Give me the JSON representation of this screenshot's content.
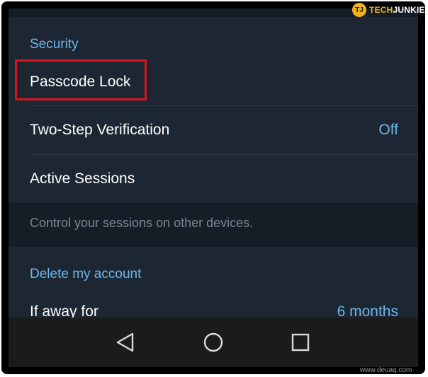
{
  "security": {
    "header": "Security",
    "passcode_lock": "Passcode Lock",
    "two_step": {
      "label": "Two-Step Verification",
      "value": "Off"
    },
    "active_sessions": "Active Sessions",
    "sessions_hint": "Control your sessions on other devices."
  },
  "delete_account": {
    "header": "Delete my account",
    "if_away": {
      "label": "If away for",
      "value": "6 months"
    }
  },
  "navbar": {
    "back": "back-triangle-icon",
    "home": "home-circle-icon",
    "recents": "recents-square-icon"
  },
  "logo": {
    "mark": "TJ",
    "tech": "TECH",
    "junkie": "JUNKIE"
  },
  "watermark": "www.deuaq.com",
  "colors": {
    "background": "#1d2733",
    "accent": "#6fb6ea",
    "highlight": "#d7141b",
    "logo": "#f3b21b"
  }
}
